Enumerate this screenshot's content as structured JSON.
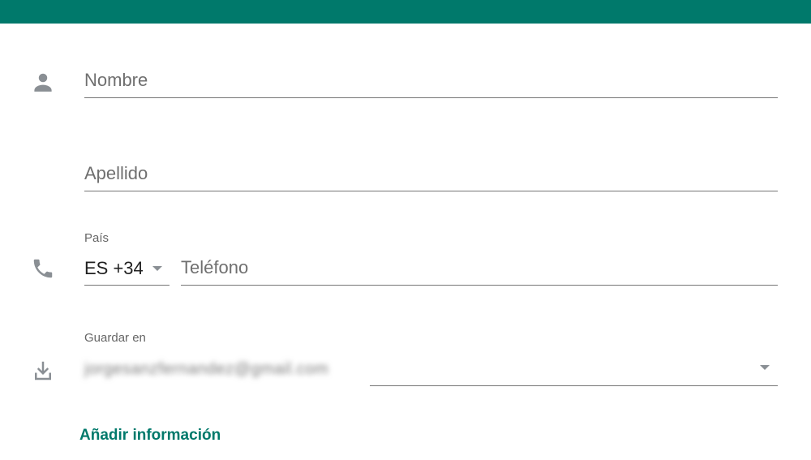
{
  "header": {
    "bar_color": "#00796b"
  },
  "form": {
    "name": {
      "icon": "person-icon",
      "placeholder": "Nombre",
      "value": ""
    },
    "surname": {
      "placeholder": "Apellido",
      "value": ""
    },
    "phone": {
      "icon": "phone-icon",
      "country_label": "País",
      "country_value": "ES +34",
      "placeholder": "Teléfono",
      "value": ""
    },
    "save_in": {
      "icon": "download-icon",
      "label": "Guardar en",
      "value": "jorgesanzfernandez@gmail.com"
    },
    "add_info_label": "Añadir información"
  }
}
